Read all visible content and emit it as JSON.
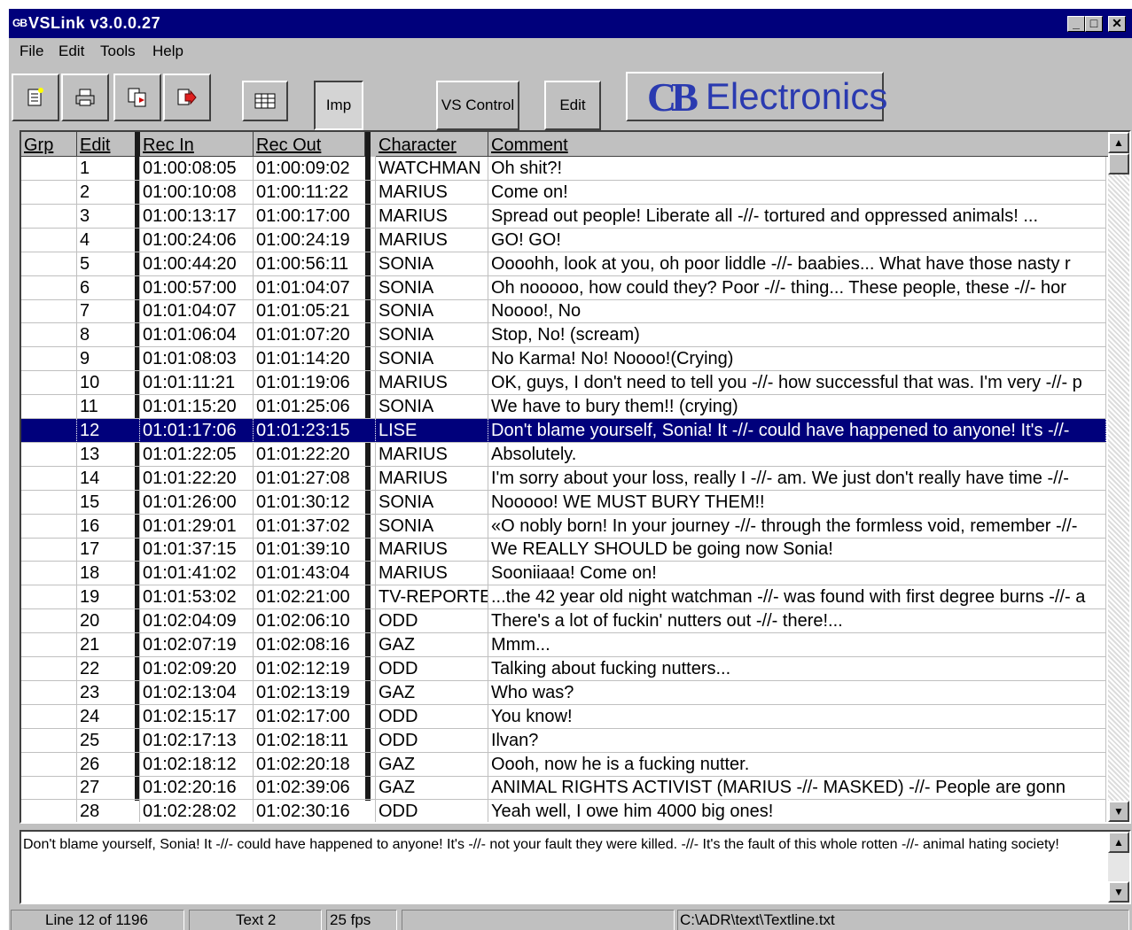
{
  "window": {
    "app_icon": "GB",
    "title": "VSLink v3.0.0.27",
    "controls": [
      "minimize-icon",
      "maximize-icon",
      "close-icon"
    ]
  },
  "menu": [
    "File",
    "Edit",
    "Tools",
    "Help"
  ],
  "toolbar": {
    "icon_buttons": [
      "new-document-icon",
      "print-icon",
      "copy-document-icon",
      "export-icon",
      "grid-icon"
    ],
    "imp_label": "Imp",
    "vs_control_label": "VS Control",
    "edit_label": "Edit",
    "logo_mark": "CB",
    "logo_text": "Electronics"
  },
  "table": {
    "columns": [
      "Grp",
      "Edit",
      "Rec In",
      "Rec Out",
      "Character",
      "Comment"
    ],
    "selected_edit": "12",
    "rows": [
      {
        "grp": "",
        "edit": "1",
        "rec_in": "01:00:08:05",
        "rec_out": "01:00:09:02",
        "character": "WATCHMAN",
        "comment": "Oh shit?!"
      },
      {
        "grp": "",
        "edit": "2",
        "rec_in": "01:00:10:08",
        "rec_out": "01:00:11:22",
        "character": "MARIUS",
        "comment": "Come on!"
      },
      {
        "grp": "",
        "edit": "3",
        "rec_in": "01:00:13:17",
        "rec_out": "01:00:17:00",
        "character": "MARIUS",
        "comment": "Spread out people! Liberate all  -//-  tortured and oppressed animals! ..."
      },
      {
        "grp": "",
        "edit": "4",
        "rec_in": "01:00:24:06",
        "rec_out": "01:00:24:19",
        "character": "MARIUS",
        "comment": "GO! GO!"
      },
      {
        "grp": "",
        "edit": "5",
        "rec_in": "01:00:44:20",
        "rec_out": "01:00:56:11",
        "character": "SONIA",
        "comment": "Oooohh, look at you, oh poor liddle  -//-  baabies... What have those nasty r"
      },
      {
        "grp": "",
        "edit": "6",
        "rec_in": "01:00:57:00",
        "rec_out": "01:01:04:07",
        "character": "SONIA",
        "comment": "Oh nooooo, how could they? Poor  -//-  thing... These people, these  -//-  hor"
      },
      {
        "grp": "",
        "edit": "7",
        "rec_in": "01:01:04:07",
        "rec_out": "01:01:05:21",
        "character": "SONIA",
        "comment": "Noooo!, No"
      },
      {
        "grp": "",
        "edit": "8",
        "rec_in": "01:01:06:04",
        "rec_out": "01:01:07:20",
        "character": "SONIA",
        "comment": "Stop, No! (scream)"
      },
      {
        "grp": "",
        "edit": "9",
        "rec_in": "01:01:08:03",
        "rec_out": "01:01:14:20",
        "character": "SONIA",
        "comment": "No Karma! No! Noooo!(Crying)"
      },
      {
        "grp": "",
        "edit": "10",
        "rec_in": "01:01:11:21",
        "rec_out": "01:01:19:06",
        "character": "MARIUS",
        "comment": "OK, guys, I don't need to tell you  -//-  how successful that was. I'm very  -//-  p"
      },
      {
        "grp": "",
        "edit": "11",
        "rec_in": "01:01:15:20",
        "rec_out": "01:01:25:06",
        "character": "SONIA",
        "comment": "We have to bury them!! (crying)"
      },
      {
        "grp": "",
        "edit": "12",
        "rec_in": "01:01:17:06",
        "rec_out": "01:01:23:15",
        "character": "LISE",
        "comment": "Don't blame yourself, Sonia! It  -//-  could have happened to anyone! It's  -//-"
      },
      {
        "grp": "",
        "edit": "13",
        "rec_in": "01:01:22:05",
        "rec_out": "01:01:22:20",
        "character": "MARIUS",
        "comment": "Absolutely."
      },
      {
        "grp": "",
        "edit": "14",
        "rec_in": "01:01:22:20",
        "rec_out": "01:01:27:08",
        "character": "MARIUS",
        "comment": "I'm sorry about your loss, really I  -//-  am. We just don't really have time  -//-"
      },
      {
        "grp": "",
        "edit": "15",
        "rec_in": "01:01:26:00",
        "rec_out": "01:01:30:12",
        "character": "SONIA",
        "comment": "Nooooo! WE MUST BURY THEM!!"
      },
      {
        "grp": "",
        "edit": "16",
        "rec_in": "01:01:29:01",
        "rec_out": "01:01:37:02",
        "character": "SONIA",
        "comment": "«O nobly born! In your journey  -//-  through the formless void, remember  -//-"
      },
      {
        "grp": "",
        "edit": "17",
        "rec_in": "01:01:37:15",
        "rec_out": "01:01:39:10",
        "character": "MARIUS",
        "comment": "We REALLY SHOULD be going now Sonia!"
      },
      {
        "grp": "",
        "edit": "18",
        "rec_in": "01:01:41:02",
        "rec_out": "01:01:43:04",
        "character": "MARIUS",
        "comment": "Sooniiaaa! Come on!"
      },
      {
        "grp": "",
        "edit": "19",
        "rec_in": "01:01:53:02",
        "rec_out": "01:02:21:00",
        "character": "TV-REPORTER",
        "comment": "...the 42 year old night watchman  -//-  was found with first degree burns  -//-  a"
      },
      {
        "grp": "",
        "edit": "20",
        "rec_in": "01:02:04:09",
        "rec_out": "01:02:06:10",
        "character": "ODD",
        "comment": "There's a lot of fuckin' nutters out  -//-  there!..."
      },
      {
        "grp": "",
        "edit": "21",
        "rec_in": "01:02:07:19",
        "rec_out": "01:02:08:16",
        "character": "GAZ",
        "comment": "Mmm..."
      },
      {
        "grp": "",
        "edit": "22",
        "rec_in": "01:02:09:20",
        "rec_out": "01:02:12:19",
        "character": "ODD",
        "comment": "Talking about fucking nutters..."
      },
      {
        "grp": "",
        "edit": "23",
        "rec_in": "01:02:13:04",
        "rec_out": "01:02:13:19",
        "character": "GAZ",
        "comment": "Who was?"
      },
      {
        "grp": "",
        "edit": "24",
        "rec_in": "01:02:15:17",
        "rec_out": "01:02:17:00",
        "character": "ODD",
        "comment": "You know!"
      },
      {
        "grp": "",
        "edit": "25",
        "rec_in": "01:02:17:13",
        "rec_out": "01:02:18:11",
        "character": "ODD",
        "comment": "Ilvan?"
      },
      {
        "grp": "",
        "edit": "26",
        "rec_in": "01:02:18:12",
        "rec_out": "01:02:20:18",
        "character": "GAZ",
        "comment": "Oooh, now he is a fucking nutter."
      },
      {
        "grp": "",
        "edit": "27",
        "rec_in": "01:02:20:16",
        "rec_out": "01:02:39:06",
        "character": "GAZ",
        "comment": "ANIMAL RIGHTS ACTIVIST (MARIUS  -//-  MASKED)  -//-  People are gonn"
      },
      {
        "grp": "",
        "edit": "28",
        "rec_in": "01:02:28:02",
        "rec_out": "01:02:30:16",
        "character": "ODD",
        "comment": "Yeah well, I owe him 4000 big ones!"
      }
    ]
  },
  "scroll_icons": {
    "up": "▲",
    "down": "▼"
  },
  "text_panel": {
    "content": "Don't blame yourself, Sonia! It  -//-  could have happened to anyone! It's  -//-  not your fault they were killed.  -//-  It's the fault of this whole rotten  -//-  animal hating society!"
  },
  "status": {
    "line": "Line 12 of 1196",
    "text": "Text 2",
    "fps": "25 fps",
    "blank": "",
    "path": "C:\\ADR\\text\\Textline.txt"
  },
  "colors": {
    "title_bar": "#00007b",
    "selection": "#00007b",
    "logo": "#2a3ab0",
    "chrome": "#c0c0c0"
  }
}
